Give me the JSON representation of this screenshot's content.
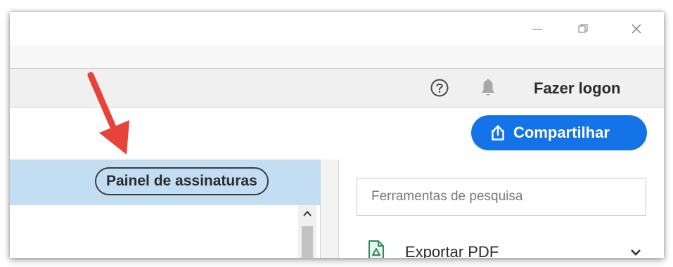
{
  "titlebar": {
    "minimize_icon": "minimize-icon",
    "restore_icon": "restore-icon",
    "close_icon": "close-icon"
  },
  "toolbar": {
    "help_icon": "help-icon",
    "notifications_icon": "bell-icon",
    "login_label": "Fazer logon"
  },
  "share": {
    "icon": "share-icon",
    "label": "Compartilhar",
    "color": "#1473e6"
  },
  "left_panel": {
    "title": "Painel de assinaturas",
    "header_color": "#c3def3"
  },
  "right_panel": {
    "search": {
      "value": "",
      "placeholder": "Ferramentas de pesquisa"
    },
    "tools": [
      {
        "icon": "export-pdf-icon",
        "label": "Exportar PDF"
      }
    ]
  },
  "annotation": {
    "arrow_color": "#e8433b"
  }
}
